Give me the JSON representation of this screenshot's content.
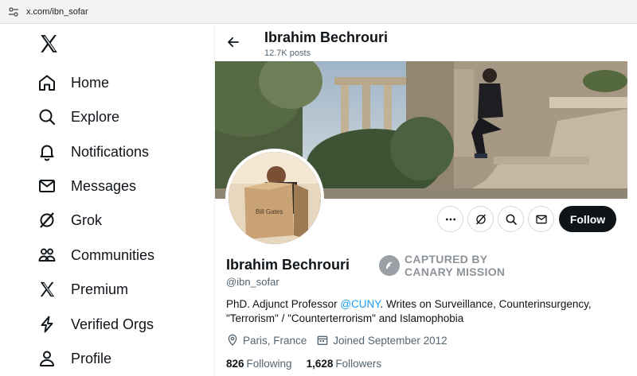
{
  "browser": {
    "url": "x.com/ibn_sofar"
  },
  "sidebar": {
    "items": [
      {
        "label": "Home",
        "icon": "home-icon"
      },
      {
        "label": "Explore",
        "icon": "search-icon"
      },
      {
        "label": "Notifications",
        "icon": "bell-icon"
      },
      {
        "label": "Messages",
        "icon": "envelope-icon"
      },
      {
        "label": "Grok",
        "icon": "grok-icon"
      },
      {
        "label": "Communities",
        "icon": "people-icon"
      },
      {
        "label": "Premium",
        "icon": "x-logo-icon"
      },
      {
        "label": "Verified Orgs",
        "icon": "lightning-icon"
      },
      {
        "label": "Profile",
        "icon": "person-icon"
      }
    ]
  },
  "header": {
    "name": "Ibrahim Bechrouri",
    "posts": "12.7K posts"
  },
  "actions": {
    "follow_label": "Follow"
  },
  "profile": {
    "display_name": "Ibrahim Bechrouri",
    "handle": "@ibn_sofar",
    "bio_before": "PhD. Adjunct Professor ",
    "bio_mention": "@CUNY",
    "bio_after": ". Writes on Surveillance, Counterinsurgency, \"Terrorism\" / \"Counterterrorism\" and Islamophobia",
    "location": "Paris, France",
    "joined": "Joined September 2012",
    "following_count": "826",
    "following_label": "Following",
    "followers_count": "1,628",
    "followers_label": "Followers"
  },
  "avatar": {
    "box_text": "Bill Gates"
  },
  "watermark": {
    "line1": "CAPTURED BY",
    "line2": "CANARY MISSION"
  },
  "colors": {
    "accent": "#1d9bf0",
    "follow_bg": "#0f1419",
    "muted": "#536471"
  }
}
